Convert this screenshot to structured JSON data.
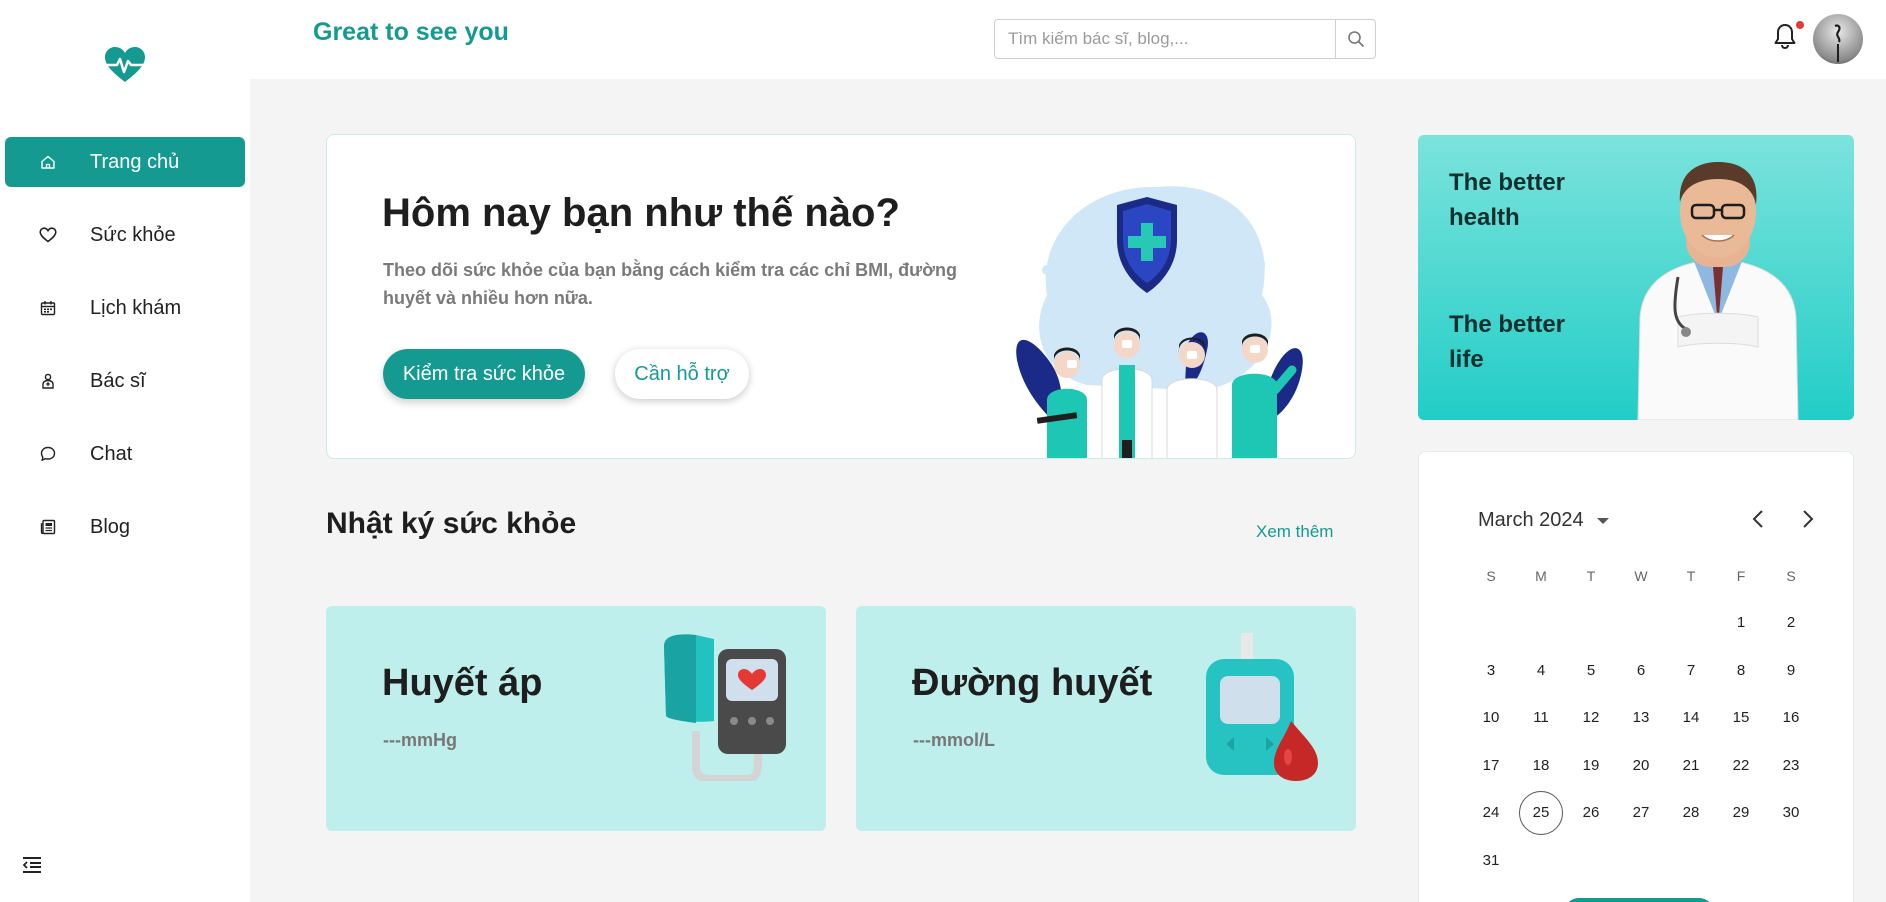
{
  "colors": {
    "accent": "#159a92",
    "accent_light": "#bfefec",
    "promo_top": "#7be3dc",
    "promo_bottom": "#22cdc7",
    "notification_dot": "#e53935"
  },
  "sidebar": {
    "logo_icon": "heartbeat-logo-icon",
    "items": [
      {
        "label": "Trang chủ",
        "icon": "home-icon",
        "active": true
      },
      {
        "label": "Sức khỏe",
        "icon": "heart-icon",
        "active": false
      },
      {
        "label": "Lịch khám",
        "icon": "calendar-icon",
        "active": false
      },
      {
        "label": "Bác sĩ",
        "icon": "doctor-icon",
        "active": false
      },
      {
        "label": "Chat",
        "icon": "chat-bubble-icon",
        "active": false
      },
      {
        "label": "Blog",
        "icon": "newspaper-icon",
        "active": false
      }
    ],
    "collapse_icon": "collapse-menu-icon"
  },
  "header": {
    "greeting": "Great to see you",
    "search_placeholder": "Tìm kiếm bác sĩ, blog,...",
    "search_icon": "search-icon",
    "bell_icon": "bell-icon",
    "has_notification": true
  },
  "hero": {
    "title": "Hôm nay bạn như thế nào?",
    "text": "Theo dõi sức khỏe của bạn bằng cách kiểm tra các chỉ BMI, đường huyết và nhiều hơn nữa.",
    "primary_button": "Kiểm tra sức khỏe",
    "secondary_button": "Cần hỗ trợ"
  },
  "diary": {
    "title": "Nhật ký sức khỏe",
    "see_more": "Xem thêm",
    "cards": [
      {
        "title": "Huyết áp",
        "value": "---mmHg",
        "icon": "blood-pressure-monitor-icon"
      },
      {
        "title": "Đường huyết",
        "value": "---mmol/L",
        "icon": "glucose-meter-icon"
      }
    ]
  },
  "promo": {
    "line1": "The better health",
    "line2": "The better life"
  },
  "calendar": {
    "month_label": "March 2024",
    "weekdays": [
      "S",
      "M",
      "T",
      "W",
      "T",
      "F",
      "S"
    ],
    "weeks": [
      [
        "",
        "",
        "",
        "",
        "",
        "1",
        "2"
      ],
      [
        "3",
        "4",
        "5",
        "6",
        "7",
        "8",
        "9"
      ],
      [
        "10",
        "11",
        "12",
        "13",
        "14",
        "15",
        "16"
      ],
      [
        "17",
        "18",
        "19",
        "20",
        "21",
        "22",
        "23"
      ],
      [
        "24",
        "25",
        "26",
        "27",
        "28",
        "29",
        "30"
      ],
      [
        "31",
        "",
        "",
        "",
        "",
        "",
        ""
      ]
    ],
    "selected_day": "25"
  }
}
